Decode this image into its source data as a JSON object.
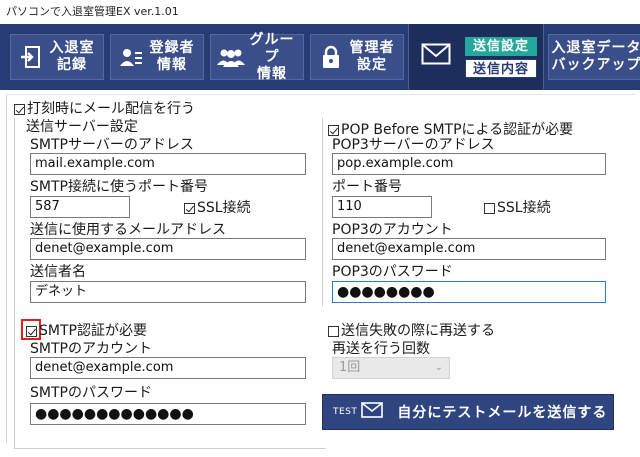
{
  "window": {
    "title": "パソコンで入退室管理EX ver.1.01"
  },
  "nav": {
    "entry": [
      "入退室",
      "記録"
    ],
    "register": [
      "登録者",
      "情報"
    ],
    "group": [
      "グループ",
      "情報"
    ],
    "admin": [
      "管理者",
      "設定"
    ],
    "send_settings": "送信設定",
    "send_content": "送信内容",
    "backup": [
      "入退室データ",
      "バックアップ"
    ]
  },
  "form": {
    "send_on_stamp": "打刻時にメール配信を行う",
    "server_section": "送信サーバー設定",
    "smtp_address_label": "SMTPサーバーのアドレス",
    "smtp_address": "mail.example.com",
    "smtp_port_label": "SMTP接続に使うポート番号",
    "smtp_port": "587",
    "smtp_ssl": "SSL接続",
    "from_address_label": "送信に使用するメールアドレス",
    "from_address": "denet@example.com",
    "sender_name_label": "送信者名",
    "sender_name": "デネット",
    "pop_before_smtp": "POP Before SMTPによる認証が必要",
    "pop3_address_label": "POP3サーバーのアドレス",
    "pop3_address": "pop.example.com",
    "pop3_port_label": "ポート番号",
    "pop3_port": "110",
    "pop3_ssl": "SSL接続",
    "pop3_account_label": "POP3のアカウント",
    "pop3_account": "denet@example.com",
    "pop3_password_label": "POP3のパスワード",
    "pop3_password": "●●●●●●●●",
    "smtp_auth": "SMTP認証が必要",
    "smtp_account_label": "SMTPのアカウント",
    "smtp_account": "denet@example.com",
    "smtp_password_label": "SMTPのパスワード",
    "smtp_password": "●●●●●●●●●●●●●",
    "resend_on_fail": "送信失敗の際に再送する",
    "resend_count_label": "再送を行う回数",
    "resend_count": "1回",
    "test_tag": "TEST",
    "test_send": "自分にテストメールを送信する"
  },
  "colors": {
    "nav_bg": "#283c74",
    "active_tab": "#24a89c",
    "highlight": "#e0201e"
  }
}
